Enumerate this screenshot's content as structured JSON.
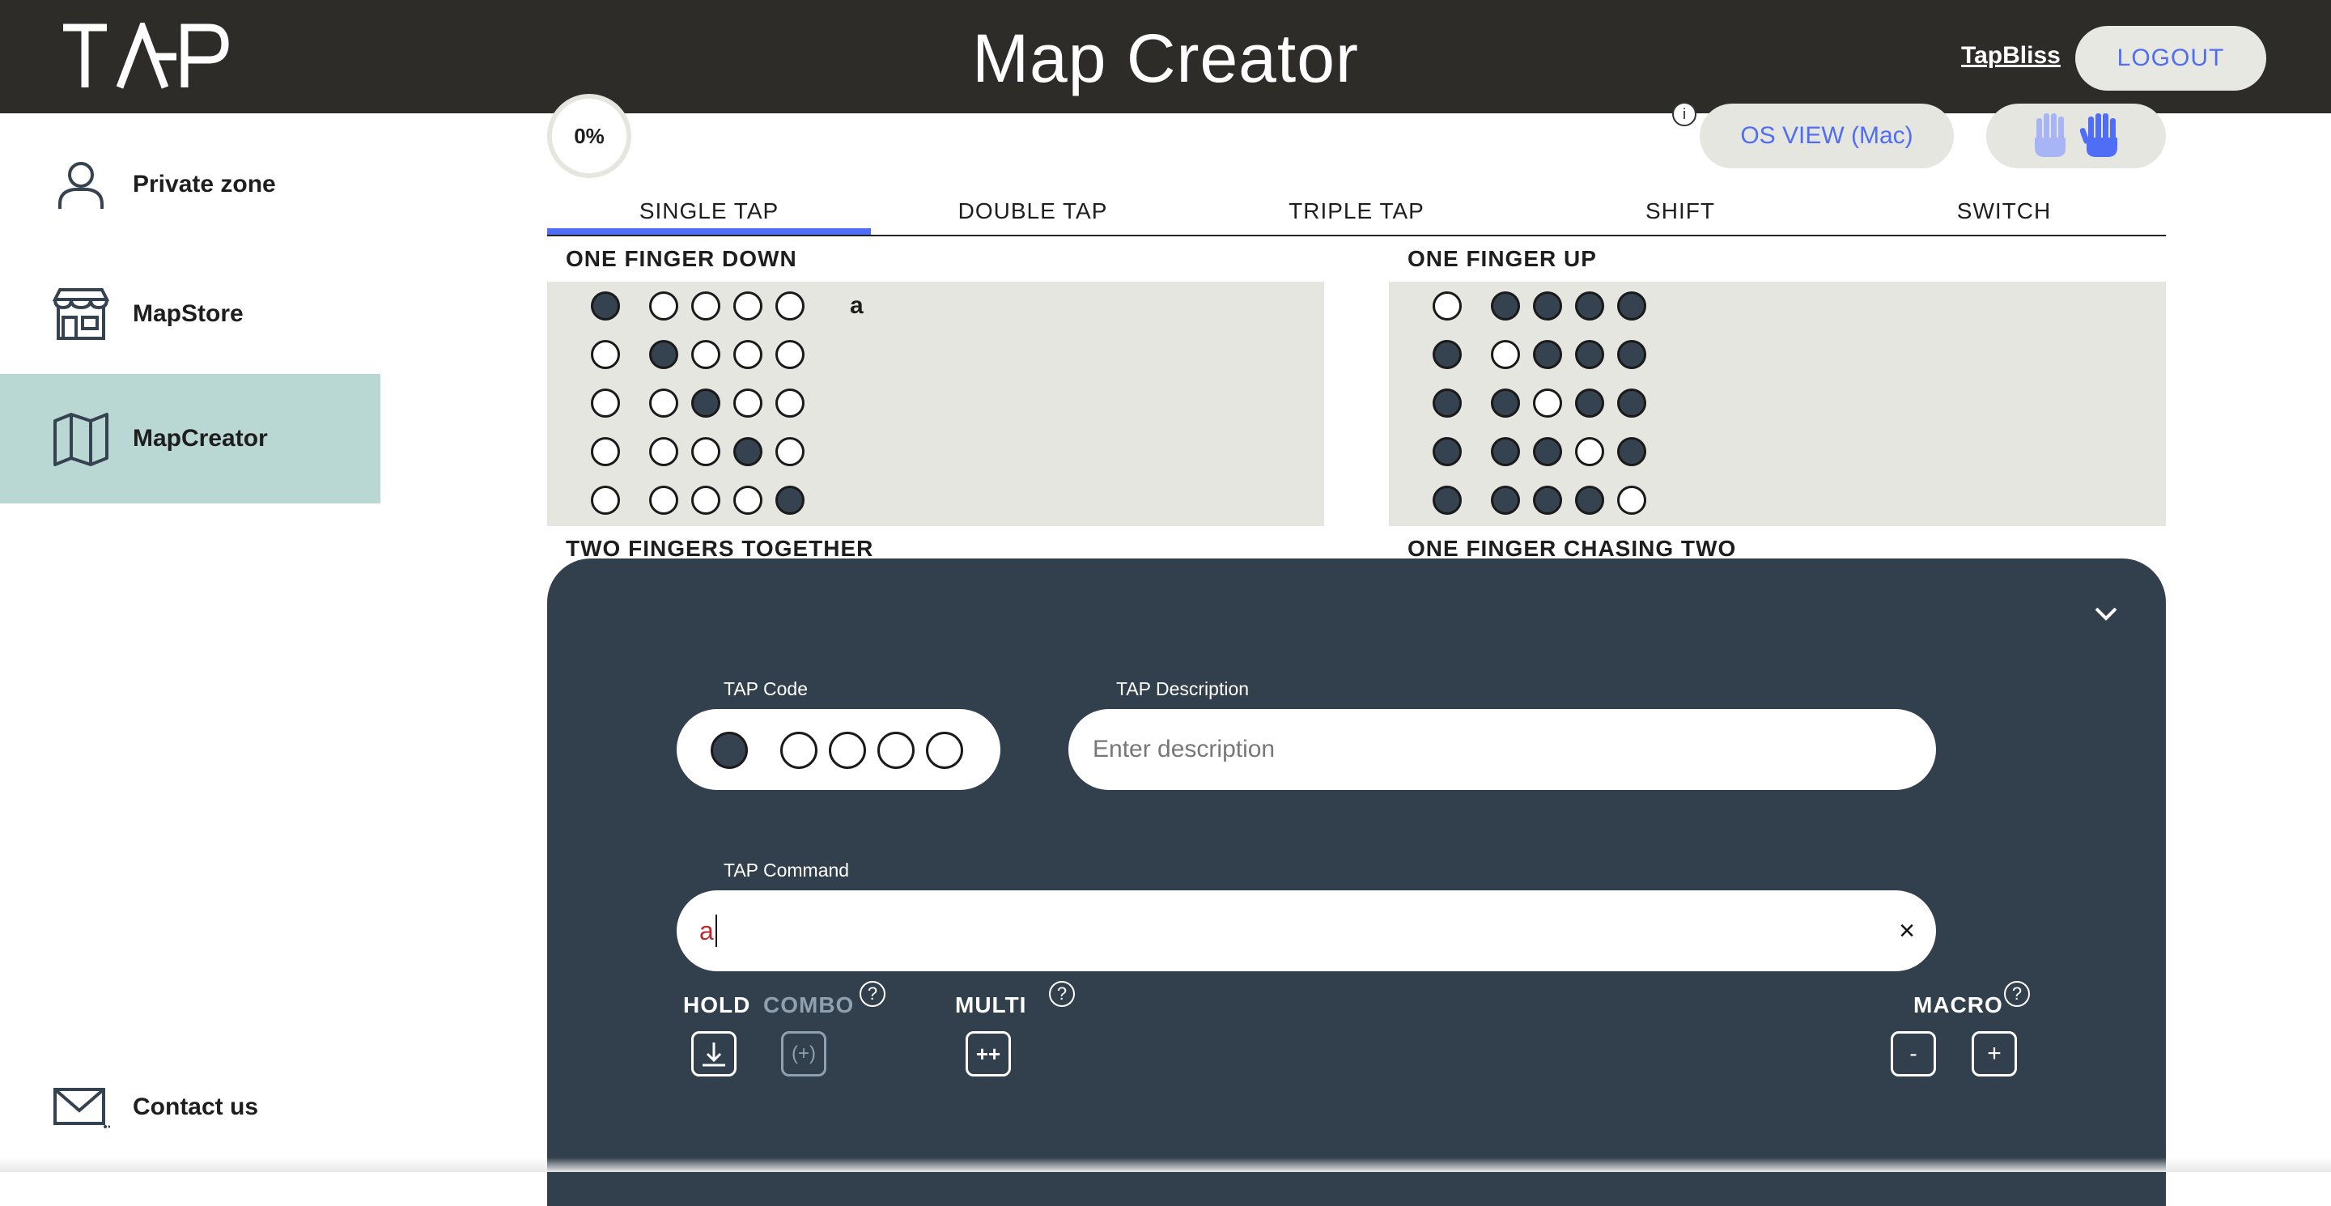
{
  "header": {
    "logo_text": "TAP",
    "title": "Map Creator",
    "user_link": "TapBliss",
    "logout_label": "LOGOUT"
  },
  "sidebar": {
    "items": [
      {
        "label": "Private zone",
        "icon": "user-icon"
      },
      {
        "label": "MapStore",
        "icon": "store-icon"
      },
      {
        "label": "MapCreator",
        "icon": "map-icon",
        "active": true
      },
      {
        "label": "Contact us",
        "icon": "mail-icon"
      }
    ]
  },
  "toolbar": {
    "progress": "0%",
    "info_glyph": "i",
    "os_view_label": "OS VIEW (Mac)"
  },
  "tabs": [
    {
      "label": "SINGLE TAP",
      "active": true
    },
    {
      "label": "DOUBLE TAP"
    },
    {
      "label": "TRIPLE TAP"
    },
    {
      "label": "SHIFT"
    },
    {
      "label": "SWITCH"
    }
  ],
  "sections": {
    "one_finger_down": {
      "title": "ONE FINGER DOWN",
      "rows": [
        {
          "code": [
            1,
            0,
            0,
            0,
            0
          ],
          "command": "a"
        },
        {
          "code": [
            0,
            1,
            0,
            0,
            0
          ],
          "command": ""
        },
        {
          "code": [
            0,
            0,
            1,
            0,
            0
          ],
          "command": ""
        },
        {
          "code": [
            0,
            0,
            0,
            1,
            0
          ],
          "command": ""
        },
        {
          "code": [
            0,
            0,
            0,
            0,
            1
          ],
          "command": ""
        }
      ]
    },
    "one_finger_up": {
      "title": "ONE FINGER UP",
      "rows": [
        {
          "code": [
            0,
            1,
            1,
            1,
            1
          ],
          "command": ""
        },
        {
          "code": [
            1,
            0,
            1,
            1,
            1
          ],
          "command": ""
        },
        {
          "code": [
            1,
            1,
            0,
            1,
            1
          ],
          "command": ""
        },
        {
          "code": [
            1,
            1,
            1,
            0,
            1
          ],
          "command": ""
        },
        {
          "code": [
            1,
            1,
            1,
            1,
            0
          ],
          "command": ""
        }
      ]
    },
    "two_fingers_together": {
      "title": "TWO FINGERS TOGETHER"
    },
    "one_finger_chasing_two": {
      "title": "ONE FINGER CHASING TWO"
    }
  },
  "editor": {
    "tap_code_label": "TAP Code",
    "tap_code": [
      1,
      0,
      0,
      0,
      0
    ],
    "description_label": "TAP Description",
    "description_placeholder": "Enter description",
    "description_value": "",
    "command_label": "TAP Command",
    "command_value": "a",
    "clear_glyph": "×",
    "options": {
      "hold": "HOLD",
      "combo": "COMBO",
      "multi": "MULTI",
      "macro": "MACRO",
      "help_glyph": "?",
      "combo_glyph": "(+)",
      "multi_glyph": "++",
      "macro_minus": "-",
      "macro_plus": "+"
    }
  },
  "colors": {
    "header_bg": "#2e2c29",
    "accent": "#4f6df5",
    "sidebar_active": "#bad8d3",
    "panel_bg": "#323f4d",
    "grid_bg": "#e6e6e0",
    "dot_filled": "#35424f",
    "command_text": "#c0272d"
  }
}
